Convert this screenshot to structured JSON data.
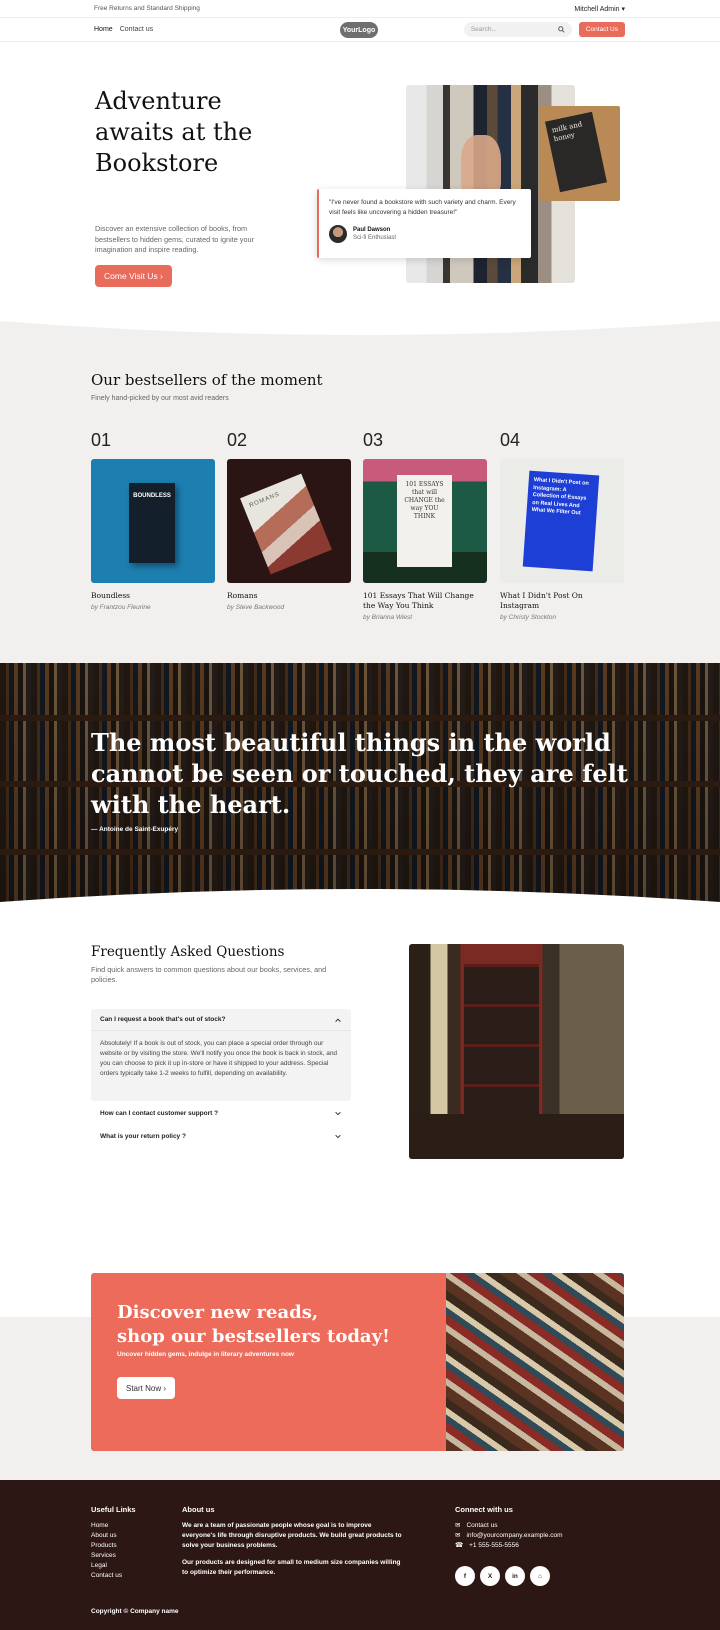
{
  "topbar": {
    "promo": "Free Returns and Standard Shipping",
    "user": "Mitchell Admin ▾"
  },
  "nav": {
    "home": "Home",
    "contact": "Contact us",
    "logo": "YourLogo",
    "search_placeholder": "Search...",
    "contact_button": "Contact Us"
  },
  "hero": {
    "title": "Adventure awaits at the Bookstore",
    "description": "Discover an extensive collection of books, from bestsellers to hidden gems, curated to ignite your imagination and inspire reading.",
    "cta": "Come Visit Us ›",
    "small_book_title": "milk and honey",
    "testimonial": {
      "quote": "\"I've never found a bookstore with such variety and charm. Every visit feels like uncovering a hidden treasure!\"",
      "name": "Paul Dawson",
      "role": "Sci-fi Enthusiast"
    }
  },
  "bestsellers": {
    "title": "Our bestsellers of the moment",
    "subtitle": "Finely hand-picked by our most avid readers",
    "books": [
      {
        "num": "01",
        "title": "Boundless",
        "author": "by Frantzou Fleurine",
        "cover_text": "BOUNDLESS"
      },
      {
        "num": "02",
        "title": "Romans",
        "author": "by Steve Backwood",
        "cover_text": "ROMANS"
      },
      {
        "num": "03",
        "title": "101 Essays That Will Change the Way You Think",
        "author": "by Brianna Wiest",
        "cover_text": "101 ESSAYS that will CHANGE the way YOU THINK"
      },
      {
        "num": "04",
        "title": "What I Didn't Post On Instagram",
        "author": "by Christy Stockton",
        "cover_text": "What I Didn't Post on Instagram: A Collection of Essays on Real Lives And What We Filter Out"
      }
    ]
  },
  "quote": {
    "text": "The most beautiful things in the world cannot be seen or touched, they are felt with the heart.",
    "author": "— Antoine de Saint-Exupéry"
  },
  "faq": {
    "title": "Frequently Asked Questions",
    "subtitle": "Find quick answers to common questions about our books, services, and policies.",
    "items": [
      {
        "q": "Can I request a book that's out of stock?",
        "a": "Absolutely! If a book is out of stock, you can place a special order through our website or by visiting the store. We'll notify you once the book is back in stock, and you can choose to pick it up in-store or have it shipped to your address. Special orders typically take 1-2 weeks to fulfill, depending on availability."
      },
      {
        "q": "How can I contact customer support ?"
      },
      {
        "q": "What is your return policy ?"
      }
    ]
  },
  "cta": {
    "title_line1": "Discover new reads,",
    "title_line2": "shop our bestsellers today!",
    "subtitle": "Uncover hidden gems, indulge in literary adventures now",
    "button": "Start Now ›"
  },
  "footer": {
    "links_title": "Useful Links",
    "links": [
      "Home",
      "About us",
      "Products",
      "Services",
      "Legal",
      "Contact us"
    ],
    "about_title": "About us",
    "about_p1": "We are a team of passionate people whose goal is to improve everyone's life through disruptive products. We build great products to solve your business problems.",
    "about_p2": "Our products are designed for small to medium size companies willing to optimize their performance.",
    "connect_title": "Connect with us",
    "contact_link": "Contact us",
    "email": "info@yourcompany.example.com",
    "phone": "+1 555-555-5556",
    "socials": [
      "f",
      "X",
      "in",
      "⌂"
    ],
    "copyright": "Copyright © Company name"
  }
}
